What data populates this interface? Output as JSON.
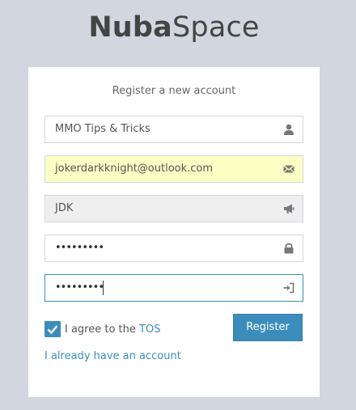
{
  "logo": {
    "bold": "Nuba",
    "light": "Space"
  },
  "box_msg": "Register a new account",
  "fields": {
    "fullname": {
      "value": "MMO Tips & Tricks",
      "icon": "user-icon"
    },
    "email": {
      "value": "jokerdarkknight@outlook.com",
      "icon": "envelope-icon",
      "state": "autofilled"
    },
    "username": {
      "value": "JDK",
      "icon": "bullhorn-icon",
      "state": "disabled"
    },
    "password": {
      "value": "•••••••••",
      "icon": "lock-icon"
    },
    "password_confirm": {
      "value": "•••••••••",
      "icon": "sign-in-icon",
      "state": "focused"
    }
  },
  "agree": {
    "checked": true,
    "text": "I agree to the ",
    "tos_link": "TOS"
  },
  "register_button": "Register",
  "have_account_link": "I already have an account",
  "colors": {
    "page_bg": "#d2d6de",
    "accent": "#3c8dbc",
    "autofill_bg": "#fbffc4",
    "disabled_bg": "#eeeeee"
  }
}
